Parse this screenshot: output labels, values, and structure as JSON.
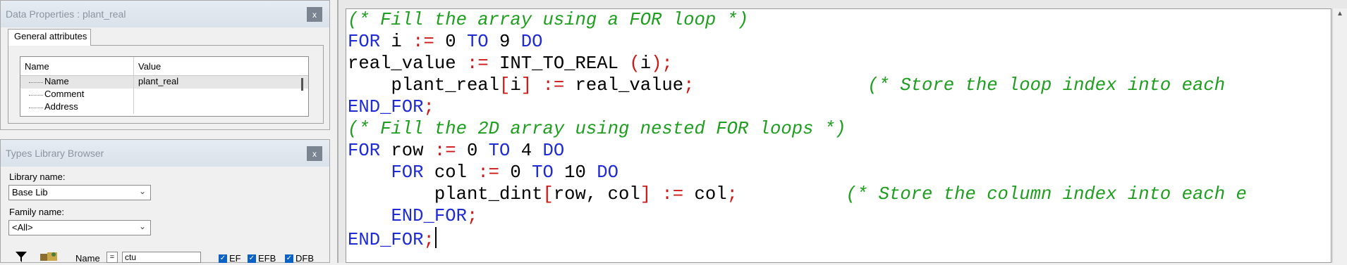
{
  "data_properties": {
    "title": "Data Properties : plant_real",
    "close": "x",
    "tab": "General attributes",
    "columns": [
      "Name",
      "Value"
    ],
    "rows": [
      {
        "name": "Name",
        "value": "plant_real"
      },
      {
        "name": "Comment",
        "value": ""
      },
      {
        "name": "Address",
        "value": ""
      }
    ]
  },
  "types_library": {
    "title": "Types Library Browser",
    "close": "x",
    "library_label": "Library name:",
    "library_value": "Base Lib",
    "family_label": "Family name:",
    "family_value": "<All>",
    "name_label": "Name",
    "equals": "=",
    "name_value": "ctu",
    "checkboxes": [
      {
        "label": "EF",
        "checked": true
      },
      {
        "label": "EFB",
        "checked": true
      },
      {
        "label": "DFB",
        "checked": true
      }
    ]
  },
  "editor": {
    "lines": [
      {
        "indent": "",
        "tokens": [
          {
            "t": "cm",
            "v": "(* Fill the array using a FOR loop *)"
          }
        ]
      },
      {
        "indent": "",
        "tokens": [
          {
            "t": "kw",
            "v": "FOR"
          },
          {
            "t": "tx",
            "v": " i "
          },
          {
            "t": "op",
            "v": ":="
          },
          {
            "t": "tx",
            "v": " 0 "
          },
          {
            "t": "kw",
            "v": "TO"
          },
          {
            "t": "tx",
            "v": " 9 "
          },
          {
            "t": "kw",
            "v": "DO"
          }
        ]
      },
      {
        "indent": "",
        "tokens": [
          {
            "t": "tx",
            "v": "real_value "
          },
          {
            "t": "op",
            "v": ":="
          },
          {
            "t": "tx",
            "v": " INT_TO_REAL "
          },
          {
            "t": "op",
            "v": "("
          },
          {
            "t": "tx",
            "v": "i"
          },
          {
            "t": "op",
            "v": ");"
          }
        ]
      },
      {
        "indent": "    ",
        "tokens": [
          {
            "t": "tx",
            "v": "plant_real"
          },
          {
            "t": "op",
            "v": "["
          },
          {
            "t": "tx",
            "v": "i"
          },
          {
            "t": "op",
            "v": "]"
          },
          {
            "t": "tx",
            "v": " "
          },
          {
            "t": "op",
            "v": ":="
          },
          {
            "t": "tx",
            "v": " real_value"
          },
          {
            "t": "op",
            "v": ";"
          },
          {
            "t": "tx",
            "v": "                "
          },
          {
            "t": "cm",
            "v": "(* Store the loop index into each"
          }
        ]
      },
      {
        "indent": "",
        "tokens": [
          {
            "t": "kw",
            "v": "END_FOR"
          },
          {
            "t": "op",
            "v": ";"
          }
        ]
      },
      {
        "indent": "",
        "tokens": [
          {
            "t": "cm",
            "v": "(* Fill the 2D array using nested FOR loops *)"
          }
        ]
      },
      {
        "indent": "",
        "tokens": [
          {
            "t": "kw",
            "v": "FOR"
          },
          {
            "t": "tx",
            "v": " row "
          },
          {
            "t": "op",
            "v": ":="
          },
          {
            "t": "tx",
            "v": " 0 "
          },
          {
            "t": "kw",
            "v": "TO"
          },
          {
            "t": "tx",
            "v": " 4 "
          },
          {
            "t": "kw",
            "v": "DO"
          }
        ]
      },
      {
        "indent": "    ",
        "tokens": [
          {
            "t": "kw",
            "v": "FOR"
          },
          {
            "t": "tx",
            "v": " col "
          },
          {
            "t": "op",
            "v": ":="
          },
          {
            "t": "tx",
            "v": " 0 "
          },
          {
            "t": "kw",
            "v": "TO"
          },
          {
            "t": "tx",
            "v": " 10 "
          },
          {
            "t": "kw",
            "v": "DO"
          }
        ]
      },
      {
        "indent": "        ",
        "tokens": [
          {
            "t": "tx",
            "v": "plant_dint"
          },
          {
            "t": "op",
            "v": "["
          },
          {
            "t": "tx",
            "v": "row, col"
          },
          {
            "t": "op",
            "v": "]"
          },
          {
            "t": "tx",
            "v": " "
          },
          {
            "t": "op",
            "v": ":="
          },
          {
            "t": "tx",
            "v": " col"
          },
          {
            "t": "op",
            "v": ";"
          },
          {
            "t": "tx",
            "v": "          "
          },
          {
            "t": "cm",
            "v": "(* Store the column index into each e"
          }
        ]
      },
      {
        "indent": "    ",
        "tokens": [
          {
            "t": "kw",
            "v": "END_FOR"
          },
          {
            "t": "op",
            "v": ";"
          }
        ]
      },
      {
        "indent": "",
        "tokens": [
          {
            "t": "kw",
            "v": "END_FOR"
          },
          {
            "t": "op",
            "v": ";"
          }
        ],
        "caret": true
      }
    ]
  }
}
